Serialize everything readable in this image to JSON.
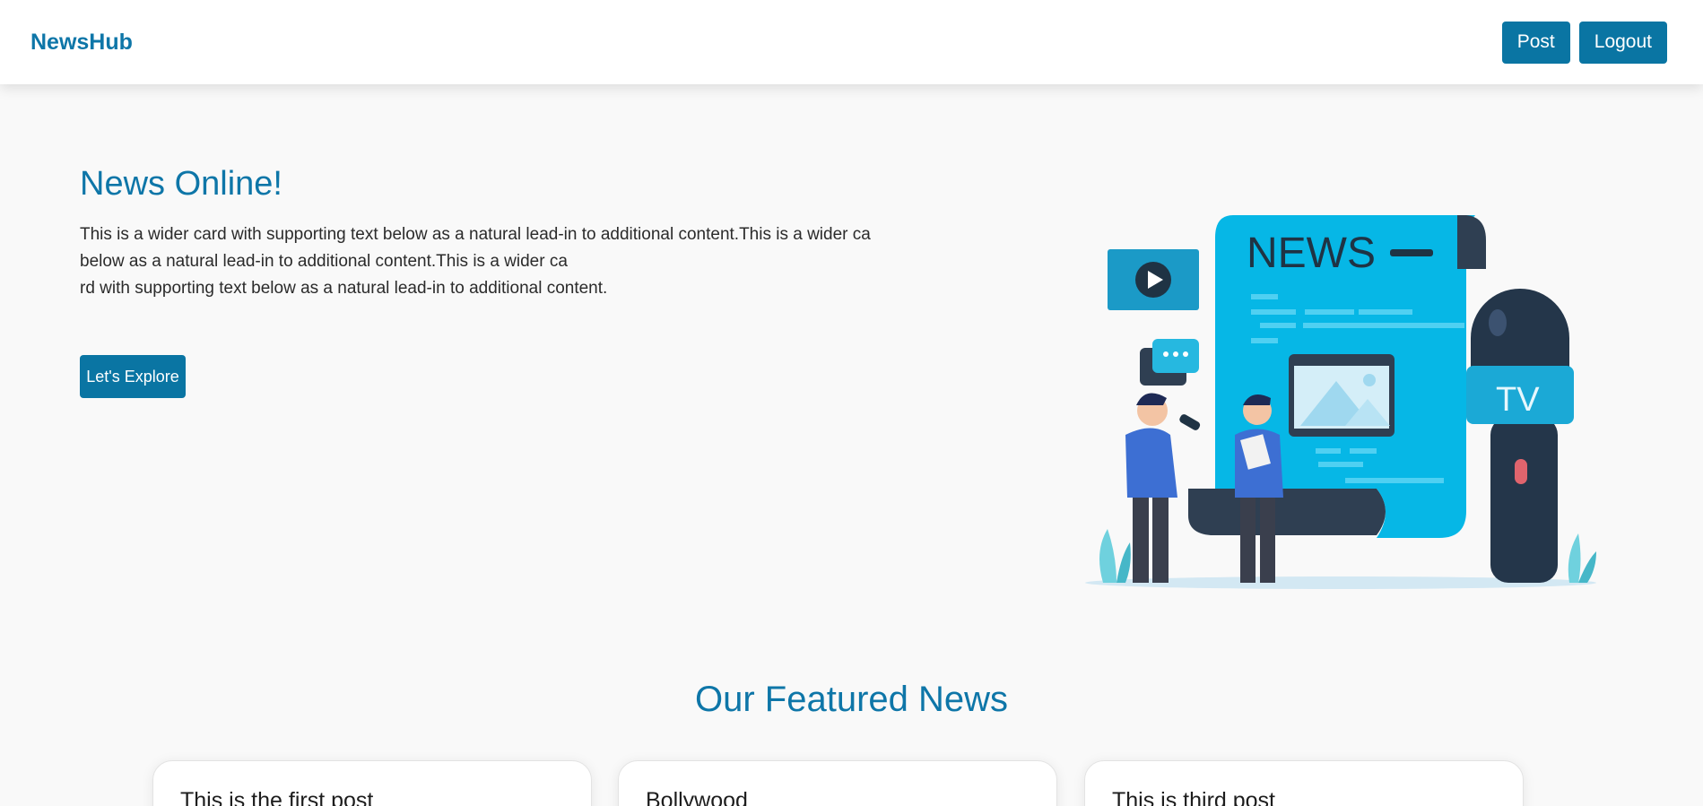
{
  "navbar": {
    "brand": "NewsHub",
    "post_label": "Post",
    "logout_label": "Logout"
  },
  "hero": {
    "title": "News Online!",
    "text_lines": [
      "This is a wider card with supporting text below as a natural lead-in to additional content.This is a wider ca",
      "below as a natural lead-in to additional content.This is a wider ca",
      "rd with supporting text below as a natural lead-in to additional content."
    ],
    "button_label": "Let's Explore"
  },
  "illustration": {
    "news_label": "NEWS",
    "tv_label": "TV"
  },
  "featured": {
    "title": "Our Featured News",
    "cards": [
      {
        "title": "This is the first post"
      },
      {
        "title": "Bollywood"
      },
      {
        "title": "This is third post"
      }
    ]
  },
  "colors": {
    "accent": "#0a75a3",
    "brand": "#0e76a8",
    "background": "#f9f9f9"
  }
}
